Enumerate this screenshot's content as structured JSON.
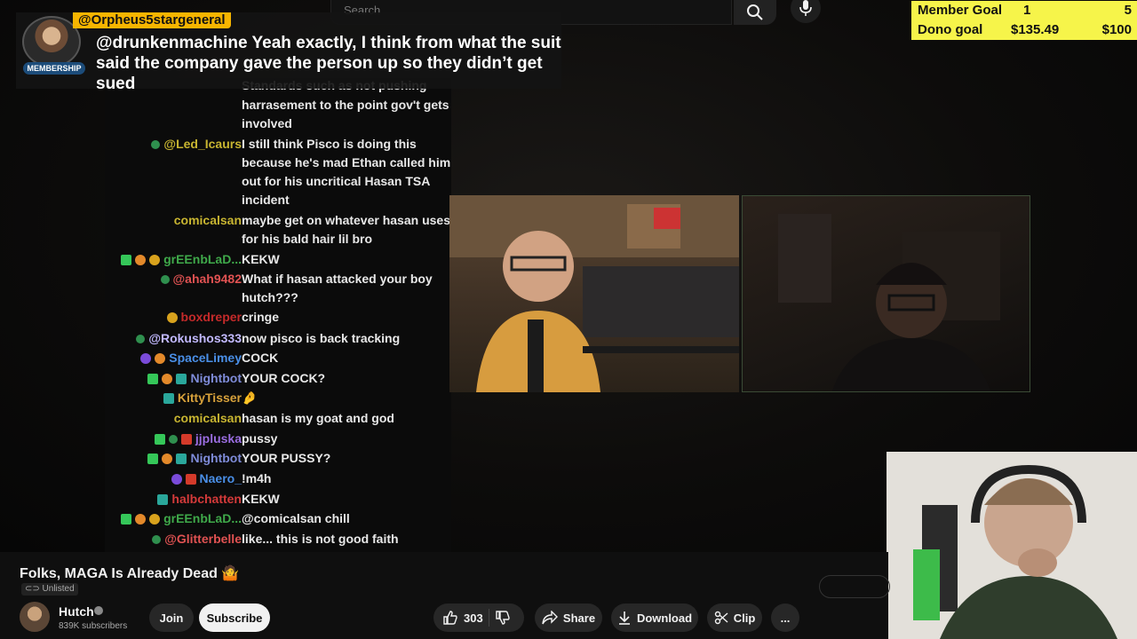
{
  "search": {
    "placeholder": "Search"
  },
  "icons": {
    "search": "search-icon",
    "mic": "mic-icon",
    "like": "thumbs-up-icon",
    "dislike": "thumbs-down-icon",
    "share": "share-icon",
    "download": "download-icon",
    "clip": "scissors-icon",
    "more": "more-icon"
  },
  "goals": {
    "member": {
      "label": "Member Goal",
      "current": "1",
      "target": "5",
      "progress": 0.2
    },
    "dono": {
      "label": "Dono goal",
      "current": "$135.49",
      "target": "$100",
      "progress": 1.0
    }
  },
  "membership_message": {
    "username": "@Orpheus5stargeneral",
    "badge": "MEMBERSHIP",
    "text": "@drunkenmachine Yeah exactly, I think from what the suit said the company gave the person up so they didn’t get sued"
  },
  "chat": [
    {
      "user": "",
      "color": "#e05a5a",
      "badges": [],
      "text": "Standards such as not pushing"
    },
    {
      "user": "",
      "color": "#e05a5a",
      "badges": [],
      "text": "harrasement to the point gov't gets involved"
    },
    {
      "user": "@Led_Icaurs",
      "color": "#c8b531",
      "badges": [
        "b-sub"
      ],
      "text": "I still think Pisco is doing this because he's mad Ethan called him out for his uncritical Hasan TSA incident"
    },
    {
      "user": "comicalsan",
      "color": "#c8b531",
      "badges": [],
      "text": "maybe get on whatever hasan uses for his bald hair lil bro"
    },
    {
      "user": "grEEnbLaD...",
      "color": "#3fa94a",
      "badges": [
        "b-green",
        "b-orange",
        "b-gold"
      ],
      "text": "KEKW"
    },
    {
      "user": "@ahah9482",
      "color": "#e05252",
      "badges": [
        "b-sub"
      ],
      "text": "What if hasan attacked your boy hutch???"
    },
    {
      "user": "boxdreper",
      "color": "#c42a2a",
      "badges": [
        "b-gold"
      ],
      "text": "cringe"
    },
    {
      "user": "@Rokushos333",
      "color": "#c2b9ff",
      "badges": [
        "b-sub"
      ],
      "text": "now pisco is back tracking"
    },
    {
      "user": "SpaceLimey",
      "color": "#4a8fe7",
      "badges": [
        "b-purple",
        "b-orange"
      ],
      "text": "COCK"
    },
    {
      "user": "Nightbot",
      "color": "#7e8bd8",
      "badges": [
        "b-green",
        "b-orange",
        "b-teal"
      ],
      "text": "YOUR COCK?"
    },
    {
      "user": "KittyTisser",
      "color": "#d7a13b",
      "badges": [
        "b-teal"
      ],
      "text": "🤌"
    },
    {
      "user": "comicalsan",
      "color": "#c8b531",
      "badges": [],
      "text": "hasan is my goat and god"
    },
    {
      "user": "jjpluska",
      "color": "#9a6de0",
      "badges": [
        "b-green",
        "b-sub",
        "b-red"
      ],
      "text": "pussy"
    },
    {
      "user": "Nightbot",
      "color": "#7e8bd8",
      "badges": [
        "b-green",
        "b-orange",
        "b-teal"
      ],
      "text": "YOUR PUSSY?"
    },
    {
      "user": "Naero_",
      "color": "#4a8fe7",
      "badges": [
        "b-purple",
        "b-red"
      ],
      "text": "!m4h"
    },
    {
      "user": "halbchatten",
      "color": "#d43a3a",
      "badges": [
        "b-teal"
      ],
      "text": "KEKW"
    },
    {
      "user": "grEEnbLaD...",
      "color": "#3fa94a",
      "badges": [
        "b-green",
        "b-orange",
        "b-gold"
      ],
      "text": "@comicalsan chill"
    },
    {
      "user": "@Glitterbelle",
      "color": "#e05252",
      "badges": [
        "b-sub"
      ],
      "text": "like... this is not good faith"
    }
  ],
  "video": {
    "title": "Folks, MAGA Is Already Dead 🤷",
    "visibility": "Unlisted",
    "channel": "Hutch",
    "subscribers": "839K subscribers",
    "join_label": "Join",
    "subscribe_label": "Subscribe",
    "likes": "303",
    "share_label": "Share",
    "download_label": "Download",
    "clip_label": "Clip",
    "more_label": "..."
  }
}
